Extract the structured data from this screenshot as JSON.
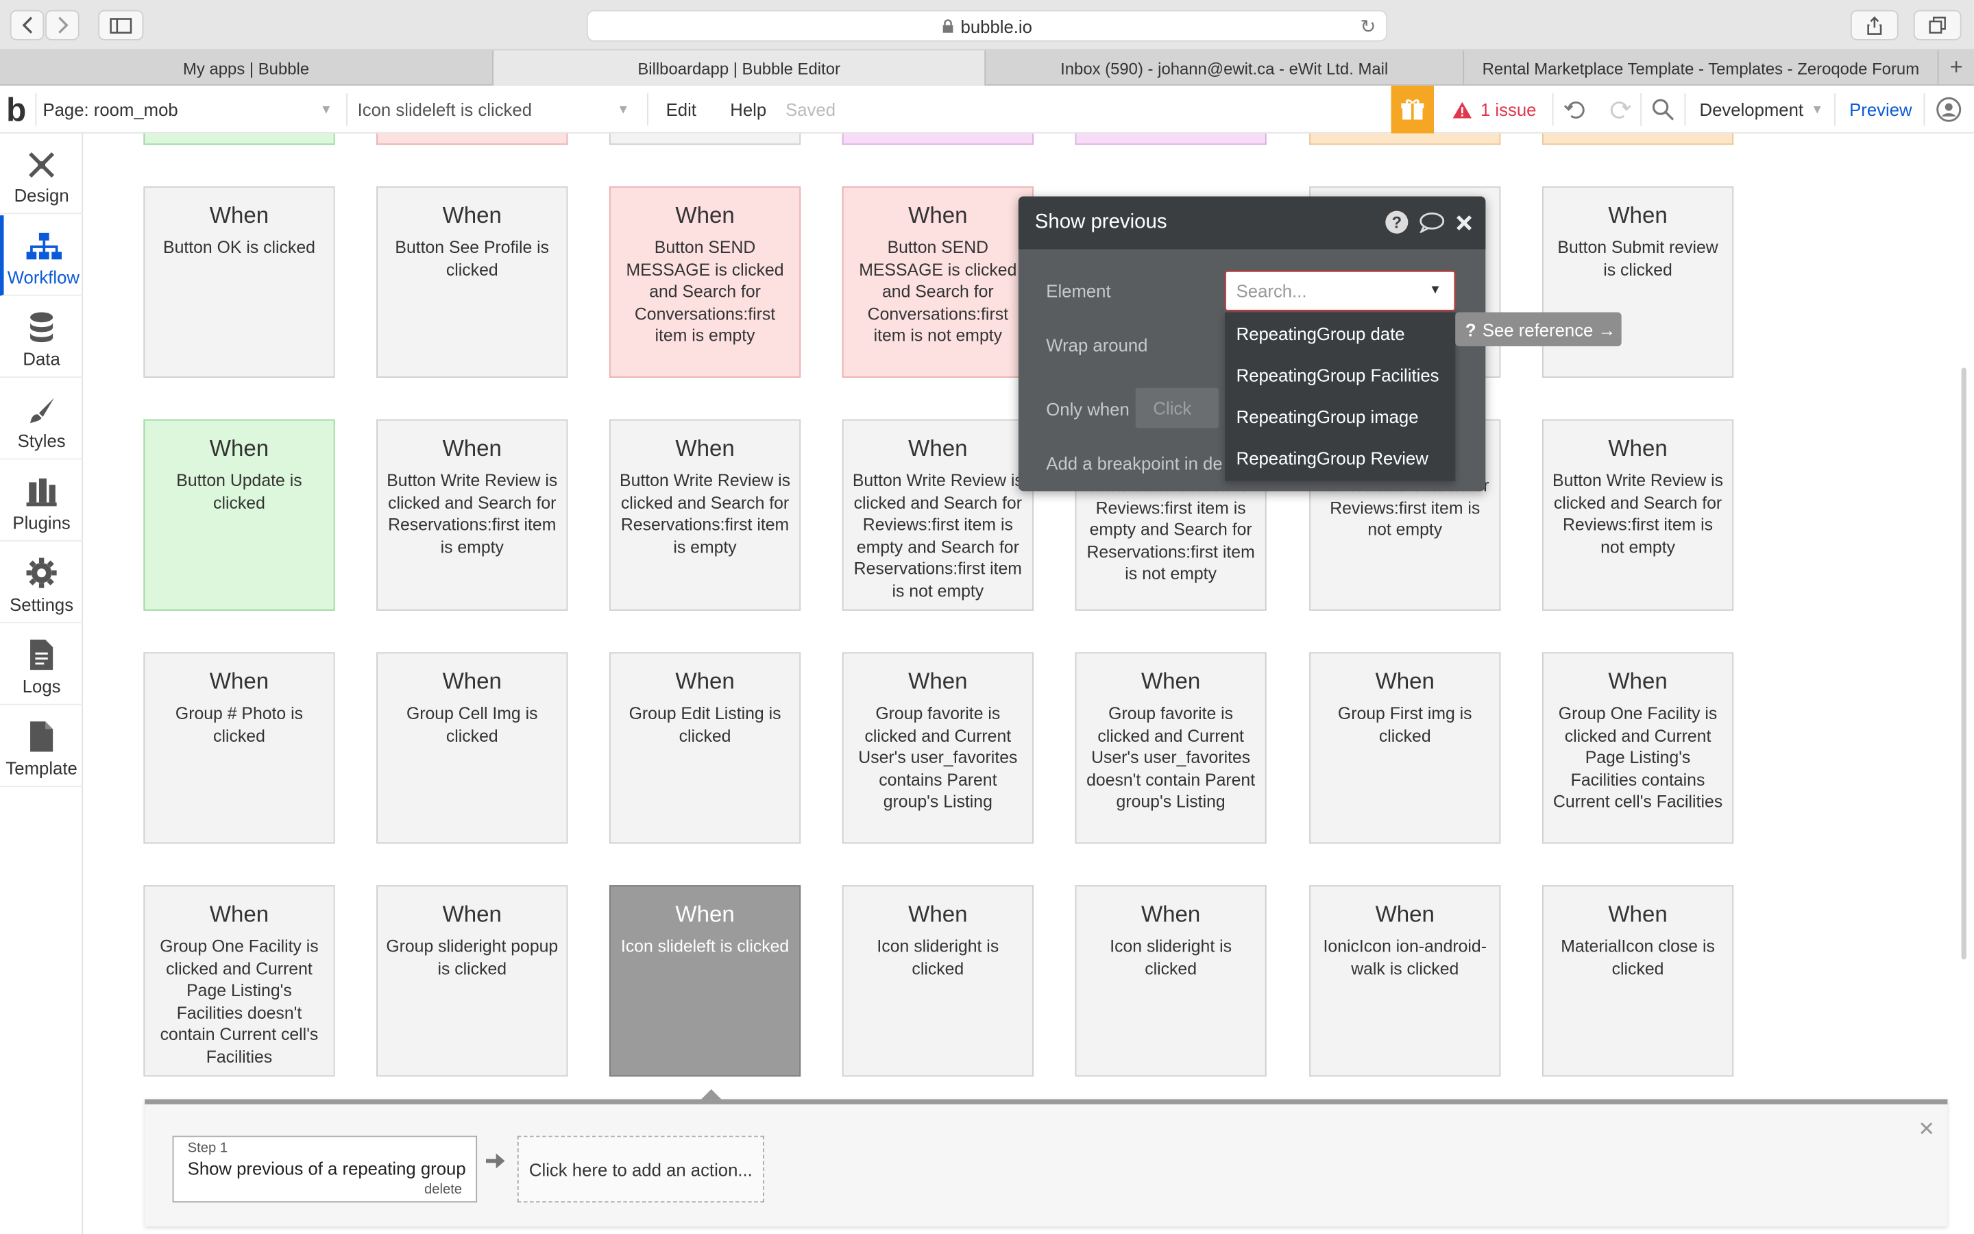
{
  "browser": {
    "url": "bubble.io",
    "tabs": [
      {
        "label": "My apps | Bubble",
        "active": false
      },
      {
        "label": "Billboardapp | Bubble Editor",
        "active": true
      },
      {
        "label": "Inbox (590) - johann@ewit.ca - eWit Ltd. Mail",
        "active": false
      },
      {
        "label": "Rental Marketplace Template - Templates - Zeroqode Forum",
        "active": false
      }
    ],
    "new_tab": "+"
  },
  "header": {
    "logo": "b",
    "page_selector": "Page: room_mob",
    "workflow_selector": "Icon slideleft is clicked",
    "edit": "Edit",
    "help": "Help",
    "saved": "Saved",
    "issues": "1 issue",
    "environment": "Development",
    "preview": "Preview",
    "accent_color": "#0b5ad9",
    "gift_color": "#f5a623",
    "issue_color": "#e0364e"
  },
  "sidebar": {
    "items": [
      {
        "label": "Design",
        "icon": "design-icon"
      },
      {
        "label": "Workflow",
        "icon": "workflow-icon",
        "active": true
      },
      {
        "label": "Data",
        "icon": "data-icon"
      },
      {
        "label": "Styles",
        "icon": "styles-icon"
      },
      {
        "label": "Plugins",
        "icon": "plugins-icon"
      },
      {
        "label": "Settings",
        "icon": "settings-icon"
      },
      {
        "label": "Logs",
        "icon": "logs-icon"
      },
      {
        "label": "Template",
        "icon": "template-icon"
      }
    ]
  },
  "workflow_cards": {
    "when": "When",
    "row1": [
      {
        "cond": "Button OK is clicked",
        "style": "plain"
      },
      {
        "cond": "Button See Profile is clicked",
        "style": "plain"
      },
      {
        "cond": "Button SEND MESSAGE is clicked and Search for Conversations:first item is empty",
        "style": "pink"
      },
      {
        "cond": "Button SEND MESSAGE is clicked and Search for Conversations:first item is not empty",
        "style": "pink"
      },
      {
        "cond": "",
        "style": "hidden"
      },
      {
        "cond": "",
        "style": "hidden"
      },
      {
        "cond": "Button Submit review is clicked",
        "style": "plain"
      }
    ],
    "row2": [
      {
        "cond": "Button Update is clicked",
        "style": "green"
      },
      {
        "cond": "Button Write Review is clicked and Search for Reservations:first item is empty",
        "style": "plain"
      },
      {
        "cond": "Button Write Review is clicked and Search for Reservations:first item is empty",
        "style": "plain"
      },
      {
        "cond": "Button Write Review is clicked and Search for Reviews:first item is empty and Search for Reservations:first item is not empty",
        "style": "plain"
      },
      {
        "cond": "clicked and Search for Reviews:first item is empty and Search for Reservations:first item is not empty",
        "style": "plain"
      },
      {
        "cond": "clicked and Search for Reviews:first item is not empty",
        "style": "plain"
      },
      {
        "cond": "Button Write Review is clicked and Search for Reviews:first item is not empty",
        "style": "plain"
      }
    ],
    "row3": [
      {
        "cond": "Group # Photo is clicked",
        "style": "plain"
      },
      {
        "cond": "Group Cell Img is clicked",
        "style": "plain"
      },
      {
        "cond": "Group Edit Listing is clicked",
        "style": "plain"
      },
      {
        "cond": "Group favorite is clicked and Current User's user_favorites contains Parent group's Listing",
        "style": "plain"
      },
      {
        "cond": "Group favorite is clicked and Current User's user_favorites doesn't contain Parent group's Listing",
        "style": "plain"
      },
      {
        "cond": "Group First img is clicked",
        "style": "plain"
      },
      {
        "cond": "Group One Facility is clicked and Current Page Listing's Facilities contains Current cell's Facilities",
        "style": "plain"
      }
    ],
    "row4": [
      {
        "cond": "Group One Facility is clicked and Current Page Listing's Facilities doesn't contain Current cell's Facilities",
        "style": "plain"
      },
      {
        "cond": "Group slideright popup is clicked",
        "style": "plain"
      },
      {
        "cond": "Icon slideleft is clicked",
        "style": "selected"
      },
      {
        "cond": "Icon slideright is clicked",
        "style": "plain"
      },
      {
        "cond": "Icon slideright is clicked",
        "style": "plain"
      },
      {
        "cond": "IonicIcon ion-android-walk is clicked",
        "style": "plain"
      },
      {
        "cond": "MaterialIcon close is clicked",
        "style": "plain"
      }
    ],
    "top_strip_colors": [
      "#dcf7dc",
      "#fde0e0",
      "#f3f3f3",
      "#f6dcf6",
      "#f6dcf6",
      "#fde6c8",
      "#fde6c8"
    ]
  },
  "popup": {
    "title": "Show previous",
    "element_label": "Element",
    "element_placeholder": "Search...",
    "wrap_label": "Wrap around",
    "only_when_label": "Only when",
    "only_when_value": "Click",
    "breakpoint_label": "Add a breakpoint in deb",
    "options": [
      "RepeatingGroup date",
      "RepeatingGroup Facilities",
      "RepeatingGroup image",
      "RepeatingGroup Review"
    ],
    "see_reference": "See reference →"
  },
  "bottom_panel": {
    "step_label": "Step 1",
    "step_title": "Show previous of a repeating group",
    "step_delete": "delete",
    "add_action": "Click here to add an action...",
    "close": "✕"
  }
}
